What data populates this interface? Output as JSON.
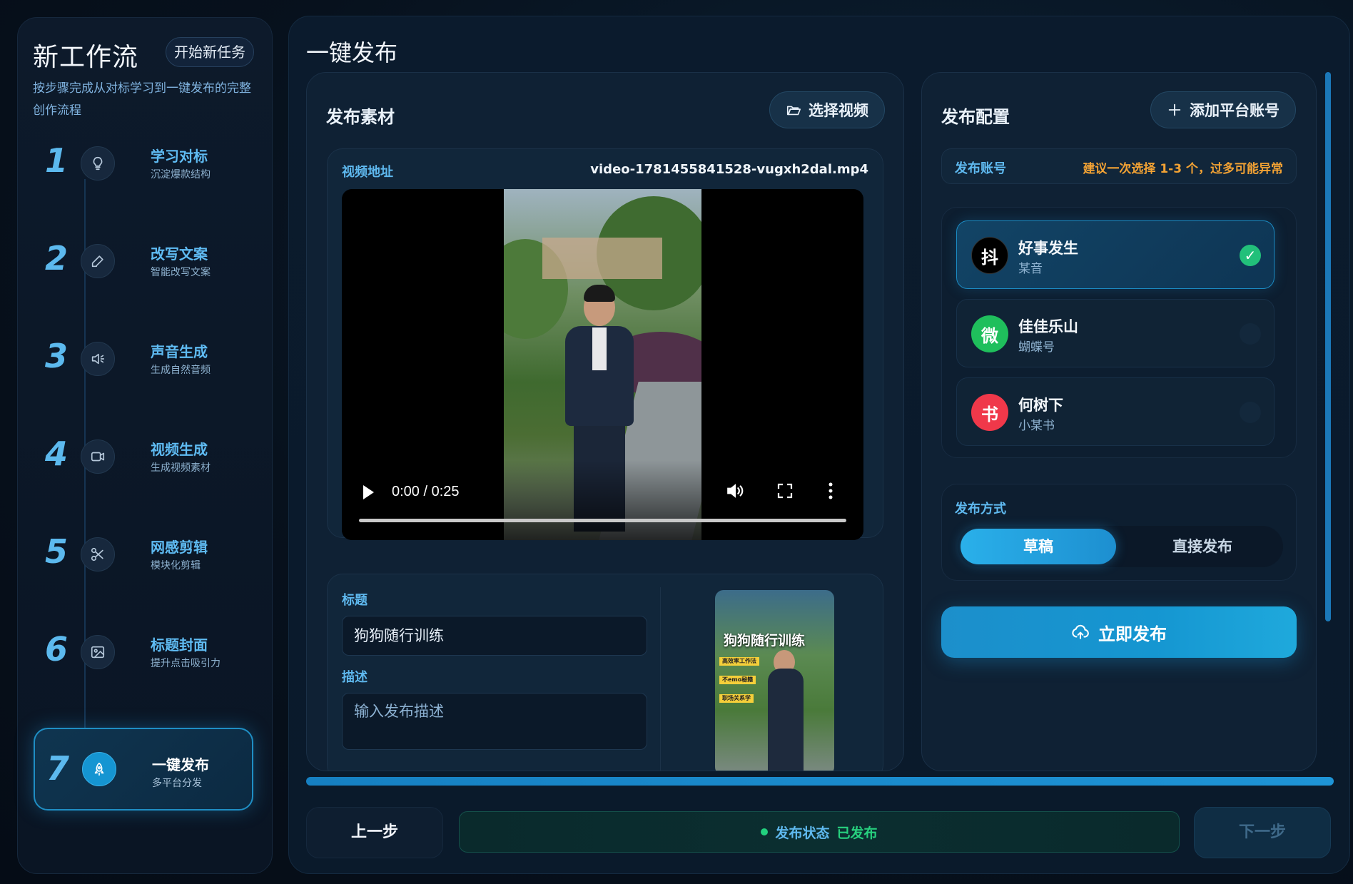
{
  "sidebar": {
    "title": "新工作流",
    "new_task_label": "开始新任务",
    "description": "按步骤完成从对标学习到一键发布的完整创作流程",
    "steps": [
      {
        "num": "1",
        "name": "学习对标",
        "sub": "沉淀爆款结构",
        "icon": "lightbulb-icon"
      },
      {
        "num": "2",
        "name": "改写文案",
        "sub": "智能改写文案",
        "icon": "pen-icon"
      },
      {
        "num": "3",
        "name": "声音生成",
        "sub": "生成自然音频",
        "icon": "speaker-icon"
      },
      {
        "num": "4",
        "name": "视频生成",
        "sub": "生成视频素材",
        "icon": "video-camera-icon"
      },
      {
        "num": "5",
        "name": "网感剪辑",
        "sub": "模块化剪辑",
        "icon": "scissors-icon"
      },
      {
        "num": "6",
        "name": "标题封面",
        "sub": "提升点击吸引力",
        "icon": "image-icon"
      },
      {
        "num": "7",
        "name": "一键发布",
        "sub": "多平台分发",
        "icon": "rocket-icon",
        "active": true
      }
    ]
  },
  "main": {
    "title": "一键发布",
    "material": {
      "heading": "发布素材",
      "select_video_label": "选择视频",
      "video_label": "视频地址",
      "video_filename": "video-1781455841528-vugxh2dal.mp4",
      "player": {
        "time": "0:00 / 0:25",
        "progress": 0
      },
      "title_label": "标题",
      "title_value": "狗狗随行训练",
      "desc_label": "描述",
      "desc_placeholder": "输入发布描述",
      "thumbnail": {
        "title": "狗狗随行训练",
        "tags": [
          "高效率工作法",
          "不emo秘籍",
          "职场关系学"
        ]
      }
    },
    "config": {
      "heading": "发布配置",
      "add_account_label": "添加平台账号",
      "accounts_label": "发布账号",
      "accounts_hint": "建议一次选择 1-3 个，过多可能异常",
      "accounts": [
        {
          "name": "好事发生",
          "platform": "某音",
          "avatar": "抖",
          "color": "#000000",
          "selected": true
        },
        {
          "name": "佳佳乐山",
          "platform": "蝴蝶号",
          "avatar": "微",
          "color": "#1fbf5c",
          "selected": false
        },
        {
          "name": "何树下",
          "platform": "小某书",
          "avatar": "书",
          "color": "#f0384a",
          "selected": false
        }
      ],
      "mode_label": "发布方式",
      "modes": [
        "草稿",
        "直接发布"
      ],
      "active_mode": "草稿",
      "publish_label": "立即发布"
    }
  },
  "footer": {
    "prev_label": "上一步",
    "status_label": "发布状态",
    "status_value": "已发布",
    "next_label": "下一步",
    "progress": 1.0
  },
  "colors": {
    "accent": "#1e94d6",
    "success": "#27d07e",
    "warning": "#f2a234",
    "label": "#5fb9ef"
  }
}
